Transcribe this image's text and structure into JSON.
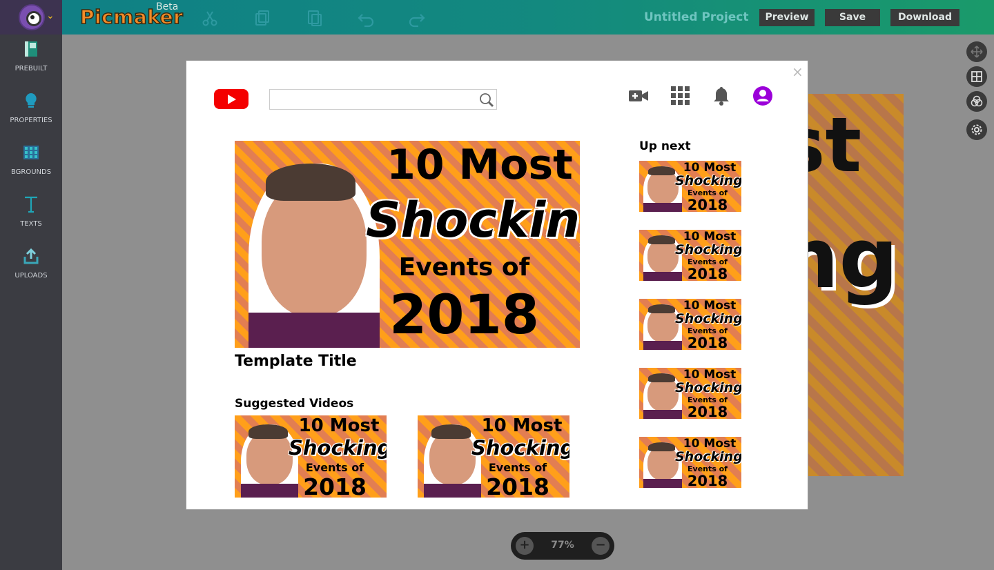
{
  "app": {
    "logo_text": "Picmaker",
    "beta_label": "Beta",
    "project_title": "Untitled Project",
    "preview_label": "Preview",
    "save_label": "Save",
    "download_label": "Download"
  },
  "toolbar": {
    "icons": [
      "scissors-icon",
      "copy-icon",
      "paste-icon",
      "undo-icon",
      "redo-icon"
    ]
  },
  "sidebar": {
    "items": [
      {
        "label": "PREBUILT",
        "icon": "prebuilt-icon"
      },
      {
        "label": "PROPERTIES",
        "icon": "bulb-icon"
      },
      {
        "label": "BGROUNDS",
        "icon": "grid-icon"
      },
      {
        "label": "TEXTS",
        "icon": "text-icon"
      },
      {
        "label": "UPLOADS",
        "icon": "upload-icon"
      }
    ]
  },
  "zoom": {
    "value": "77%",
    "plus": "+",
    "minus": "−"
  },
  "modal": {
    "close_glyph": "×",
    "search_placeholder": "",
    "template_title": "Template Title",
    "suggested_label": "Suggested Videos",
    "up_next_label": "Up next",
    "thumbnail": {
      "line1": "10 Most",
      "line2": "Shocking",
      "line3": "Events of",
      "line4": "2018"
    }
  },
  "background_canvas": {
    "line1": "st",
    "line2": "ng"
  },
  "colors": {
    "accent_teal": "#13897f",
    "youtube_red": "#f40000",
    "avatar_purple": "#9b00d9",
    "thumb_orange": "#ff9f1a"
  }
}
